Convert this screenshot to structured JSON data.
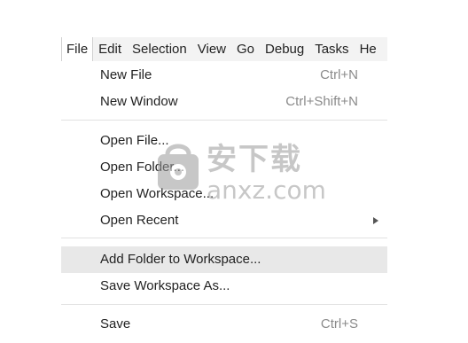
{
  "menubar": {
    "items": [
      {
        "label": "File",
        "active": true
      },
      {
        "label": "Edit",
        "active": false
      },
      {
        "label": "Selection",
        "active": false
      },
      {
        "label": "View",
        "active": false
      },
      {
        "label": "Go",
        "active": false
      },
      {
        "label": "Debug",
        "active": false
      },
      {
        "label": "Tasks",
        "active": false
      },
      {
        "label": "He",
        "active": false
      }
    ]
  },
  "file_menu": {
    "items": [
      {
        "label": "New File",
        "shortcut": "Ctrl+N"
      },
      {
        "label": "New Window",
        "shortcut": "Ctrl+Shift+N"
      },
      {
        "label": "Open File...",
        "shortcut": ""
      },
      {
        "label": "Open Folder...",
        "shortcut": ""
      },
      {
        "label": "Open Workspace...",
        "shortcut": ""
      },
      {
        "label": "Open Recent",
        "shortcut": "",
        "submenu": true
      },
      {
        "label": "Add Folder to Workspace...",
        "shortcut": "",
        "highlighted": true
      },
      {
        "label": "Save Workspace As...",
        "shortcut": ""
      },
      {
        "label": "Save",
        "shortcut": "Ctrl+S"
      }
    ]
  },
  "watermark": {
    "icon": "shopping-bag-icon",
    "text_cn": "安下载",
    "text_en": "anxz.com"
  },
  "colors": {
    "menubar_bg": "#f3f3f3",
    "highlight_bg": "#e8e8e8",
    "shortcut_text": "#8a8a8a",
    "watermark": "#9a9a9a"
  }
}
